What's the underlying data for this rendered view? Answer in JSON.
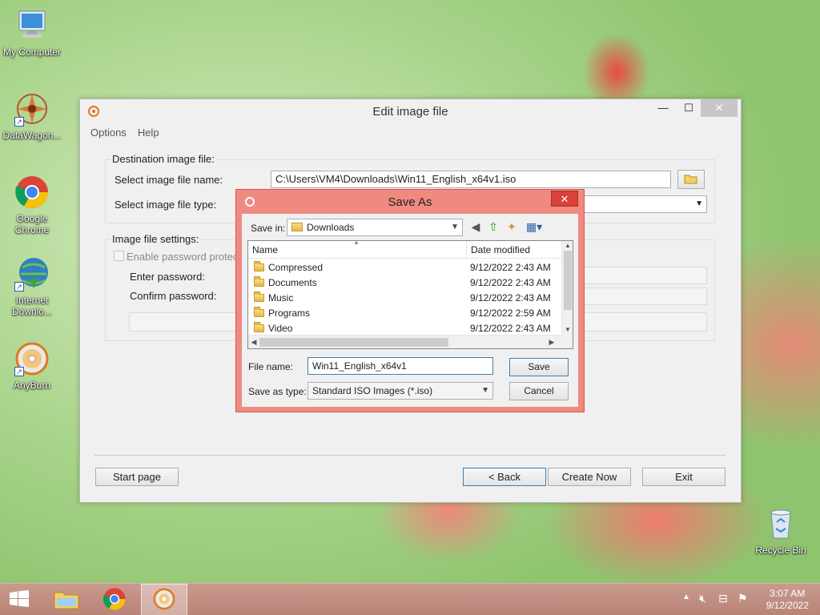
{
  "desktop": {
    "icons": [
      {
        "label": "My Computer",
        "icon": "computer-icon"
      },
      {
        "label": "DataWagon...",
        "icon": "datawagon-icon"
      },
      {
        "label": "Google Chrome",
        "icon": "chrome-icon"
      },
      {
        "label": "Internet Downlo...",
        "icon": "idm-icon"
      },
      {
        "label": "AnyBurn",
        "icon": "anyburn-icon"
      },
      {
        "label": "Recycle Bin",
        "icon": "recycle-bin-icon"
      }
    ]
  },
  "main_window": {
    "title": "Edit image file",
    "controls": {
      "minimize": "—",
      "maximize": "☐",
      "close": "✕"
    },
    "menu": [
      "Options",
      "Help"
    ],
    "destination": {
      "legend": "Destination image file:",
      "name_label": "Select image file name:",
      "name_value": "C:\\Users\\VM4\\Downloads\\Win11_English_x64v1.iso",
      "type_label": "Select image file type:"
    },
    "settings": {
      "legend": "Image file settings:",
      "enable_password": "Enable password protect",
      "enter_password": "Enter password:",
      "confirm_password": "Confirm password:"
    },
    "buttons": {
      "start_page": "Start page",
      "back": "< Back",
      "create_now": "Create Now",
      "exit": "Exit"
    }
  },
  "save_dialog": {
    "title": "Save As",
    "close": "✕",
    "save_in_label": "Save in:",
    "save_in_value": "Downloads",
    "columns": {
      "name": "Name",
      "date": "Date modified"
    },
    "rows": [
      {
        "name": "Compressed",
        "date": "9/12/2022 2:43 AM"
      },
      {
        "name": "Documents",
        "date": "9/12/2022 2:43 AM"
      },
      {
        "name": "Music",
        "date": "9/12/2022 2:43 AM"
      },
      {
        "name": "Programs",
        "date": "9/12/2022 2:59 AM"
      },
      {
        "name": "Video",
        "date": "9/12/2022 2:43 AM"
      }
    ],
    "file_name_label": "File name:",
    "file_name_value": "Win11_English_x64v1",
    "save_type_label": "Save as type:",
    "save_type_value": "Standard ISO Images (*.iso)",
    "save_button": "Save",
    "cancel_button": "Cancel"
  },
  "taskbar": {
    "time": "3:07 AM",
    "date": "9/12/2022"
  }
}
